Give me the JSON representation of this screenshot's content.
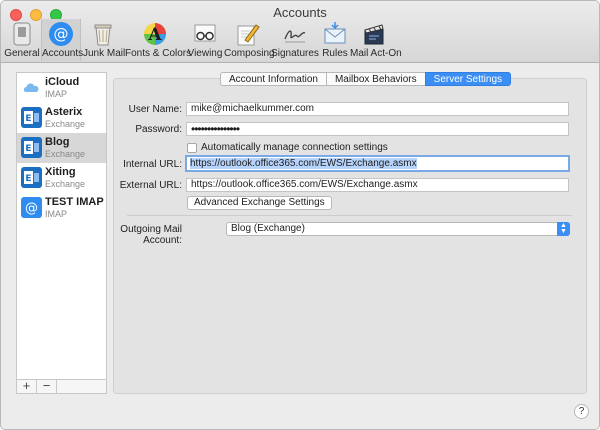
{
  "window": {
    "title": "Accounts"
  },
  "toolbar": {
    "items": [
      {
        "label": "General",
        "icon": "general-switch-icon"
      },
      {
        "label": "Accounts",
        "icon": "at-sign-icon",
        "selected": true
      },
      {
        "label": "Junk Mail",
        "icon": "trash-bin-icon"
      },
      {
        "label": "Fonts & Colors",
        "icon": "fonts-colors-icon"
      },
      {
        "label": "Viewing",
        "icon": "glasses-icon"
      },
      {
        "label": "Composing",
        "icon": "pencil-paper-icon"
      },
      {
        "label": "Signatures",
        "icon": "signature-icon"
      },
      {
        "label": "Rules",
        "icon": "rules-envelope-icon"
      },
      {
        "label": "Mail Act-On",
        "icon": "clapperboard-icon"
      }
    ]
  },
  "sidebar": {
    "accounts": [
      {
        "name": "iCloud",
        "type": "IMAP",
        "icon": "cloud-icon"
      },
      {
        "name": "Asterix",
        "type": "Exchange",
        "icon": "exchange-icon"
      },
      {
        "name": "Blog",
        "type": "Exchange",
        "icon": "exchange-icon",
        "selected": true
      },
      {
        "name": "Xiting",
        "type": "Exchange",
        "icon": "exchange-icon"
      },
      {
        "name": "TEST IMAP",
        "type": "IMAP",
        "icon": "at-sign-icon"
      }
    ],
    "add_label": "+",
    "remove_label": "−"
  },
  "tabs": [
    {
      "label": "Account Information"
    },
    {
      "label": "Mailbox Behaviors"
    },
    {
      "label": "Server Settings",
      "active": true
    }
  ],
  "form": {
    "user_name_label": "User Name:",
    "user_name_value": "mike@michaelkummer.com",
    "password_label": "Password:",
    "password_value": "•••••••••••••••",
    "auto_manage_label": "Automatically manage connection settings",
    "auto_manage_checked": false,
    "internal_url_label": "Internal URL:",
    "internal_url_value": "https://outlook.office365.com/EWS/Exchange.asmx",
    "external_url_label": "External URL:",
    "external_url_value": "https://outlook.office365.com/EWS/Exchange.asmx",
    "advanced_button": "Advanced Exchange Settings",
    "outgoing_label": "Outgoing Mail Account:",
    "outgoing_value": "Blog (Exchange)"
  },
  "help_label": "?",
  "colors": {
    "accent": "#3a8ef4",
    "selection": "#b6d3fb"
  }
}
